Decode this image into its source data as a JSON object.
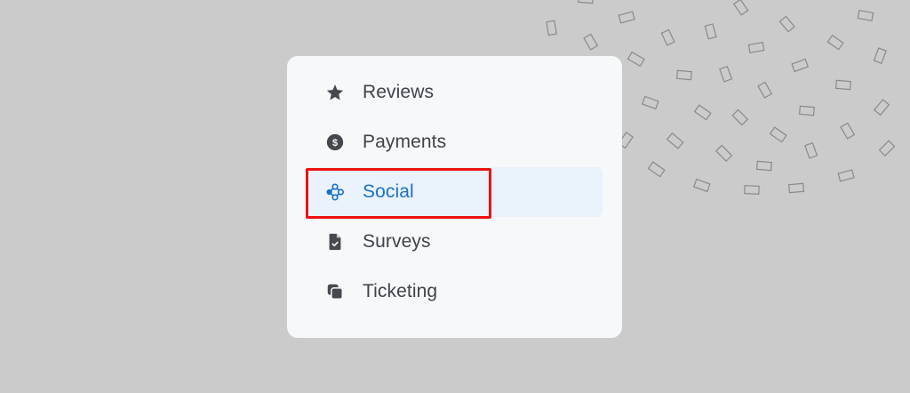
{
  "menu": {
    "items": [
      {
        "id": "reviews",
        "label": "Reviews",
        "icon": "star-icon",
        "active": false
      },
      {
        "id": "payments",
        "label": "Payments",
        "icon": "dollar-circle-icon",
        "active": false
      },
      {
        "id": "social",
        "label": "Social",
        "icon": "social-network-icon",
        "active": true
      },
      {
        "id": "surveys",
        "label": "Surveys",
        "icon": "survey-document-icon",
        "active": false
      },
      {
        "id": "ticketing",
        "label": "Ticketing",
        "icon": "ticket-stack-icon",
        "active": false
      }
    ]
  },
  "colors": {
    "background": "#cbcbcb",
    "card": "#f7f8fa",
    "text": "#3f4349",
    "icon": "#45484d",
    "active_text": "#1a73c8",
    "active_background": "#eaf2fc",
    "highlight_border": "#ee1111"
  }
}
